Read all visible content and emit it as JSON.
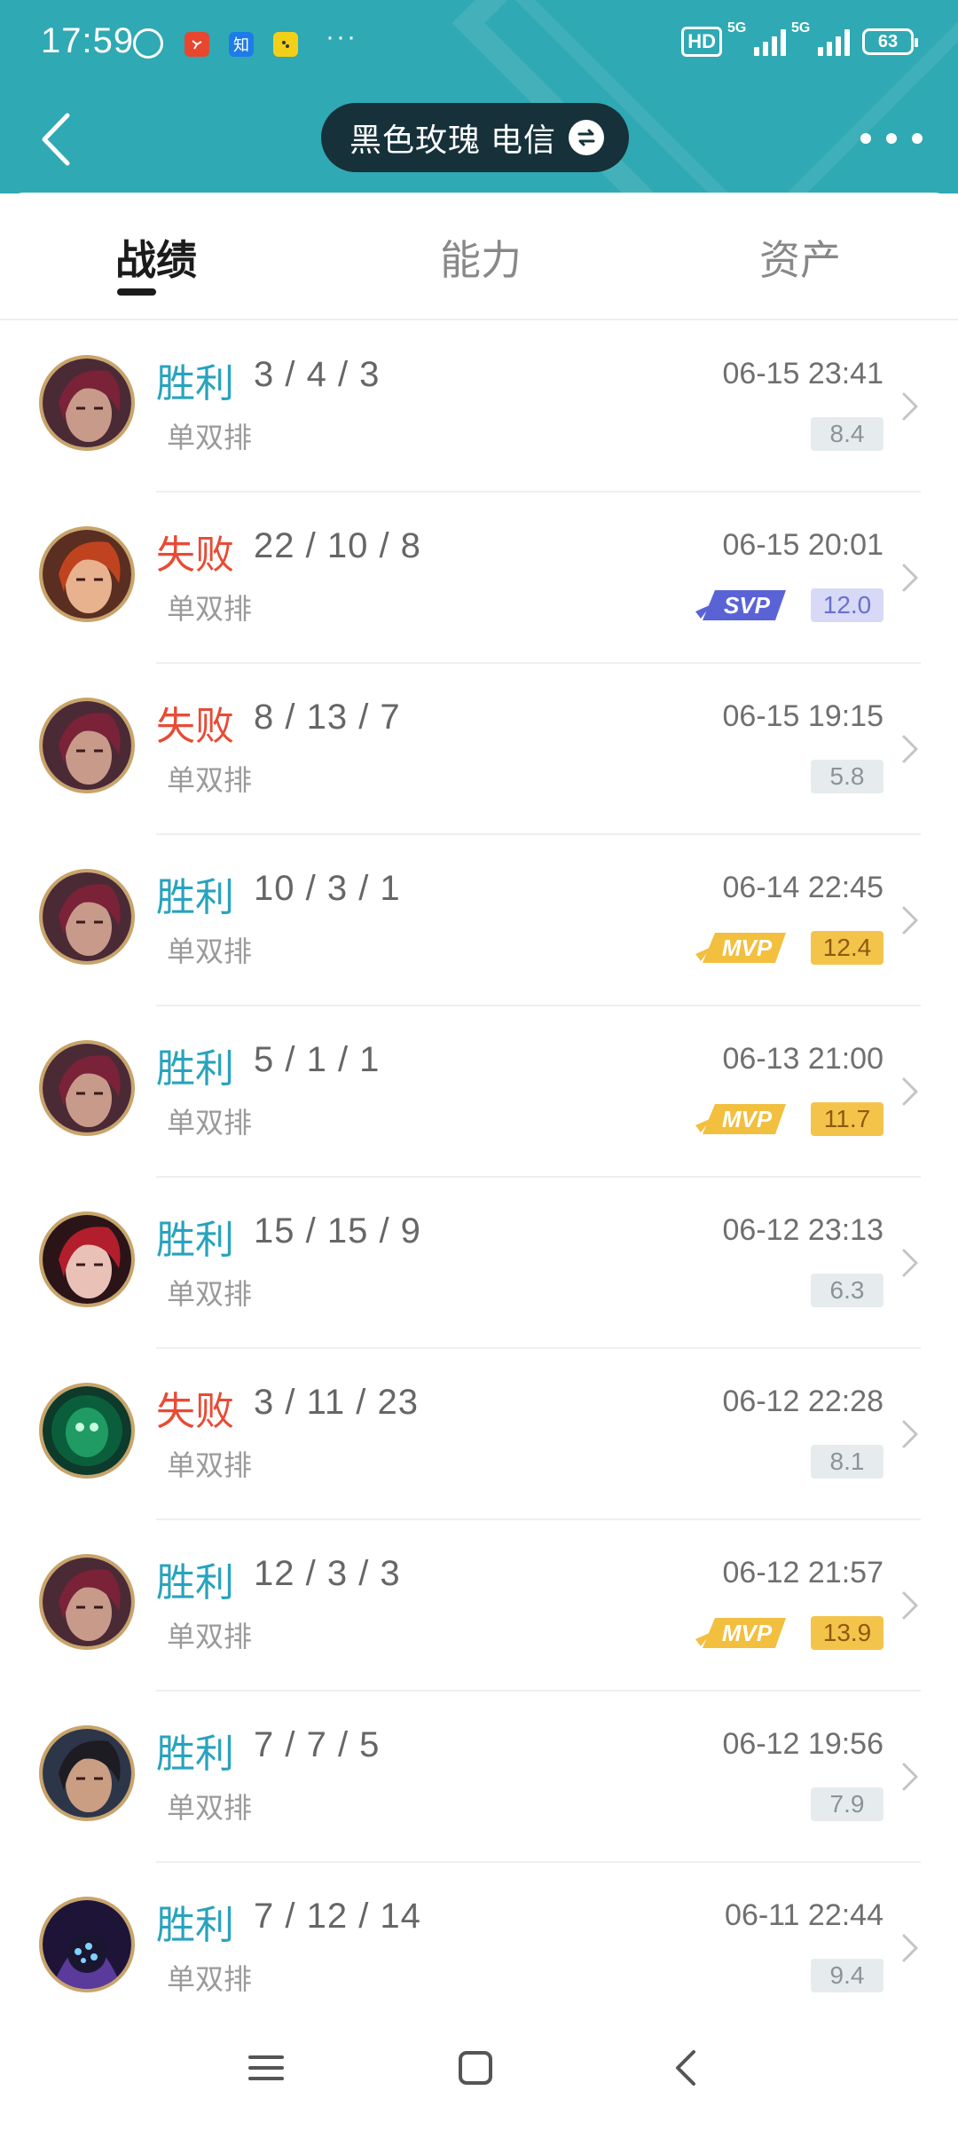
{
  "status_bar": {
    "time": "17:59",
    "app_icon_2": "知",
    "network_label": "HD",
    "sim1_label": "5G",
    "sim2_label": "5G",
    "battery": "63"
  },
  "header": {
    "account_name": "黑色玫瑰 电信",
    "back_icon": "chevron-left-icon",
    "switch_icon": "swap-icon",
    "more_icon": "more-dots-icon",
    "colors": {
      "header_bg": "#2fa9b3",
      "pill_bg": "#16313a"
    }
  },
  "tabs": [
    {
      "label": "战绩",
      "active": true
    },
    {
      "label": "能力",
      "active": false
    },
    {
      "label": "资产",
      "active": false
    }
  ],
  "matches": [
    {
      "result": "胜利",
      "outcome": "win",
      "kda": "3 / 4 / 3",
      "mode": "单双排",
      "date": "06-15 23:41",
      "score": "8.4",
      "badge": "none",
      "champion_icon": "champion-portrait-a-icon"
    },
    {
      "result": "失败",
      "outcome": "lose",
      "kda": "22 / 10 / 8",
      "mode": "单双排",
      "date": "06-15 20:01",
      "score": "12.0",
      "badge": "svp",
      "badge_text": "SVP",
      "champion_icon": "champion-portrait-b-icon"
    },
    {
      "result": "失败",
      "outcome": "lose",
      "kda": "8 / 13 / 7",
      "mode": "单双排",
      "date": "06-15 19:15",
      "score": "5.8",
      "badge": "none",
      "champion_icon": "champion-portrait-a-icon"
    },
    {
      "result": "胜利",
      "outcome": "win",
      "kda": "10 / 3 / 1",
      "mode": "单双排",
      "date": "06-14 22:45",
      "score": "12.4",
      "badge": "mvp",
      "badge_text": "MVP",
      "champion_icon": "champion-portrait-a-icon"
    },
    {
      "result": "胜利",
      "outcome": "win",
      "kda": "5 / 1 / 1",
      "mode": "单双排",
      "date": "06-13 21:00",
      "score": "11.7",
      "badge": "mvp",
      "badge_text": "MVP",
      "champion_icon": "champion-portrait-a-icon"
    },
    {
      "result": "胜利",
      "outcome": "win",
      "kda": "15 / 15 / 9",
      "mode": "单双排",
      "date": "06-12 23:13",
      "score": "6.3",
      "badge": "none",
      "champion_icon": "champion-portrait-c-icon"
    },
    {
      "result": "失败",
      "outcome": "lose",
      "kda": "3 / 11 / 23",
      "mode": "单双排",
      "date": "06-12 22:28",
      "score": "8.1",
      "badge": "none",
      "champion_icon": "champion-portrait-d-icon"
    },
    {
      "result": "胜利",
      "outcome": "win",
      "kda": "12 / 3 / 3",
      "mode": "单双排",
      "date": "06-12 21:57",
      "score": "13.9",
      "badge": "mvp",
      "badge_text": "MVP",
      "champion_icon": "champion-portrait-a-icon"
    },
    {
      "result": "胜利",
      "outcome": "win",
      "kda": "7 / 7 / 5",
      "mode": "单双排",
      "date": "06-12 19:56",
      "score": "7.9",
      "badge": "none",
      "champion_icon": "champion-portrait-e-icon"
    },
    {
      "result": "胜利",
      "outcome": "win",
      "kda": "7 / 12 / 14",
      "mode": "单双排",
      "date": "06-11 22:44",
      "score": "9.4",
      "badge": "none",
      "champion_icon": "champion-portrait-f-icon"
    }
  ],
  "colors": {
    "win": "#28a3bd",
    "lose": "#e84b35",
    "mvp": "#f4c44a",
    "svp": "#d7d9f7",
    "score_normal": "#e6ecee"
  },
  "nav_bar": {
    "menu_icon": "menu-icon",
    "home_icon": "home-square-icon",
    "back_icon": "back-chevron-icon"
  }
}
